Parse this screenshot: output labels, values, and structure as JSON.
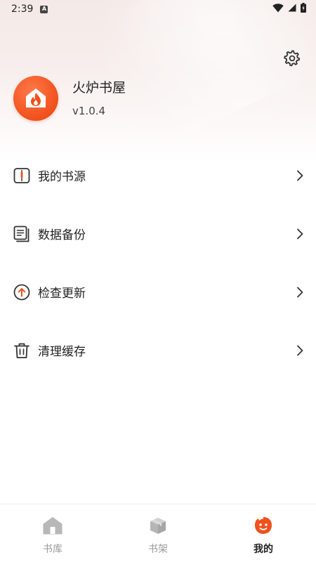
{
  "status_bar": {
    "time": "2:39",
    "notification_icon": "A"
  },
  "header": {
    "settings_icon": "gear-icon",
    "app_name": "火炉书屋",
    "version": "v1.0.4"
  },
  "menu": {
    "items": [
      {
        "label": "我的书源",
        "icon": "book-source-icon"
      },
      {
        "label": "数据备份",
        "icon": "backup-icon"
      },
      {
        "label": "检查更新",
        "icon": "update-icon"
      },
      {
        "label": "清理缓存",
        "icon": "trash-icon"
      }
    ]
  },
  "tab_bar": {
    "tabs": [
      {
        "label": "书库",
        "icon": "home-icon",
        "active": false
      },
      {
        "label": "书架",
        "icon": "bookshelf-icon",
        "active": false
      },
      {
        "label": "我的",
        "icon": "profile-icon",
        "active": true
      }
    ]
  },
  "colors": {
    "accent": "#f0501c",
    "inactive": "#b5b5b5",
    "text": "#222222"
  }
}
